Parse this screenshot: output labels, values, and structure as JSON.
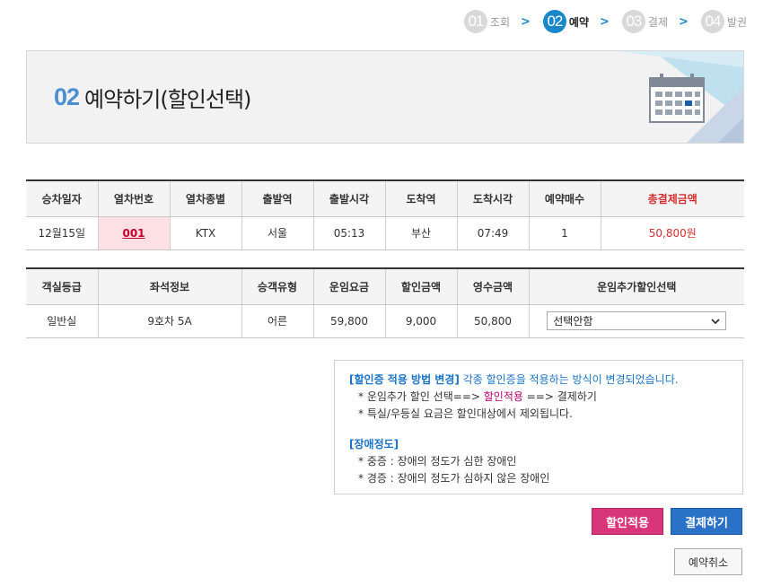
{
  "steps": [
    {
      "num": "01",
      "label": "조회"
    },
    {
      "num": "02",
      "label": "예약"
    },
    {
      "num": "03",
      "label": "결제"
    },
    {
      "num": "04",
      "label": "발권"
    }
  ],
  "step_separator": ">",
  "banner": {
    "num": "02",
    "title": "예약하기(할인선택)"
  },
  "reservation_table": {
    "headers": [
      "승차일자",
      "열차번호",
      "열차종별",
      "출발역",
      "출발시각",
      "도착역",
      "도착시각",
      "예약매수",
      "총결제금액"
    ],
    "row": {
      "date": "12월15일",
      "train_no": "001",
      "train_type": "KTX",
      "dep_station": "서울",
      "dep_time": "05:13",
      "arr_station": "부산",
      "arr_time": "07:49",
      "count": "1",
      "total": "50,800원"
    }
  },
  "fare_table": {
    "headers": [
      "객실등급",
      "좌석정보",
      "승객유형",
      "운임요금",
      "할인금액",
      "영수금액",
      "운임추가할인선택"
    ],
    "row": {
      "class": "일반실",
      "seat": "9호차 5A",
      "passenger": "어른",
      "fare": "59,800",
      "discount": "9,000",
      "receipt": "50,800",
      "discount_select": "선택안함"
    }
  },
  "notice": {
    "heading1": "[할인증 적용 방법 변경]",
    "heading1_text": " 각종 할인증을 적용하는 방식이 변경되었습니다.",
    "line1_a": "* 운임추가 할인 선택==> ",
    "line1_b": "할인적용",
    "line1_c": " ==> 결제하기",
    "line2": "* 특실/우등실 요금은 할인대상에서 제외됩니다.",
    "heading2": "[장애정도]",
    "line3": "* 중증 : 장애의 정도가 심한 장애인",
    "line4": "* 경증 : 장애의 정도가 심하지 않은 장애인"
  },
  "buttons": {
    "apply": "할인적용",
    "pay": "결제하기",
    "cancel": "예약취소"
  },
  "colors": {
    "accent_blue": "#1a88c8",
    "apply_pink": "#d9357a",
    "pay_blue": "#2a72c7",
    "total_red": "#d32f2f"
  }
}
